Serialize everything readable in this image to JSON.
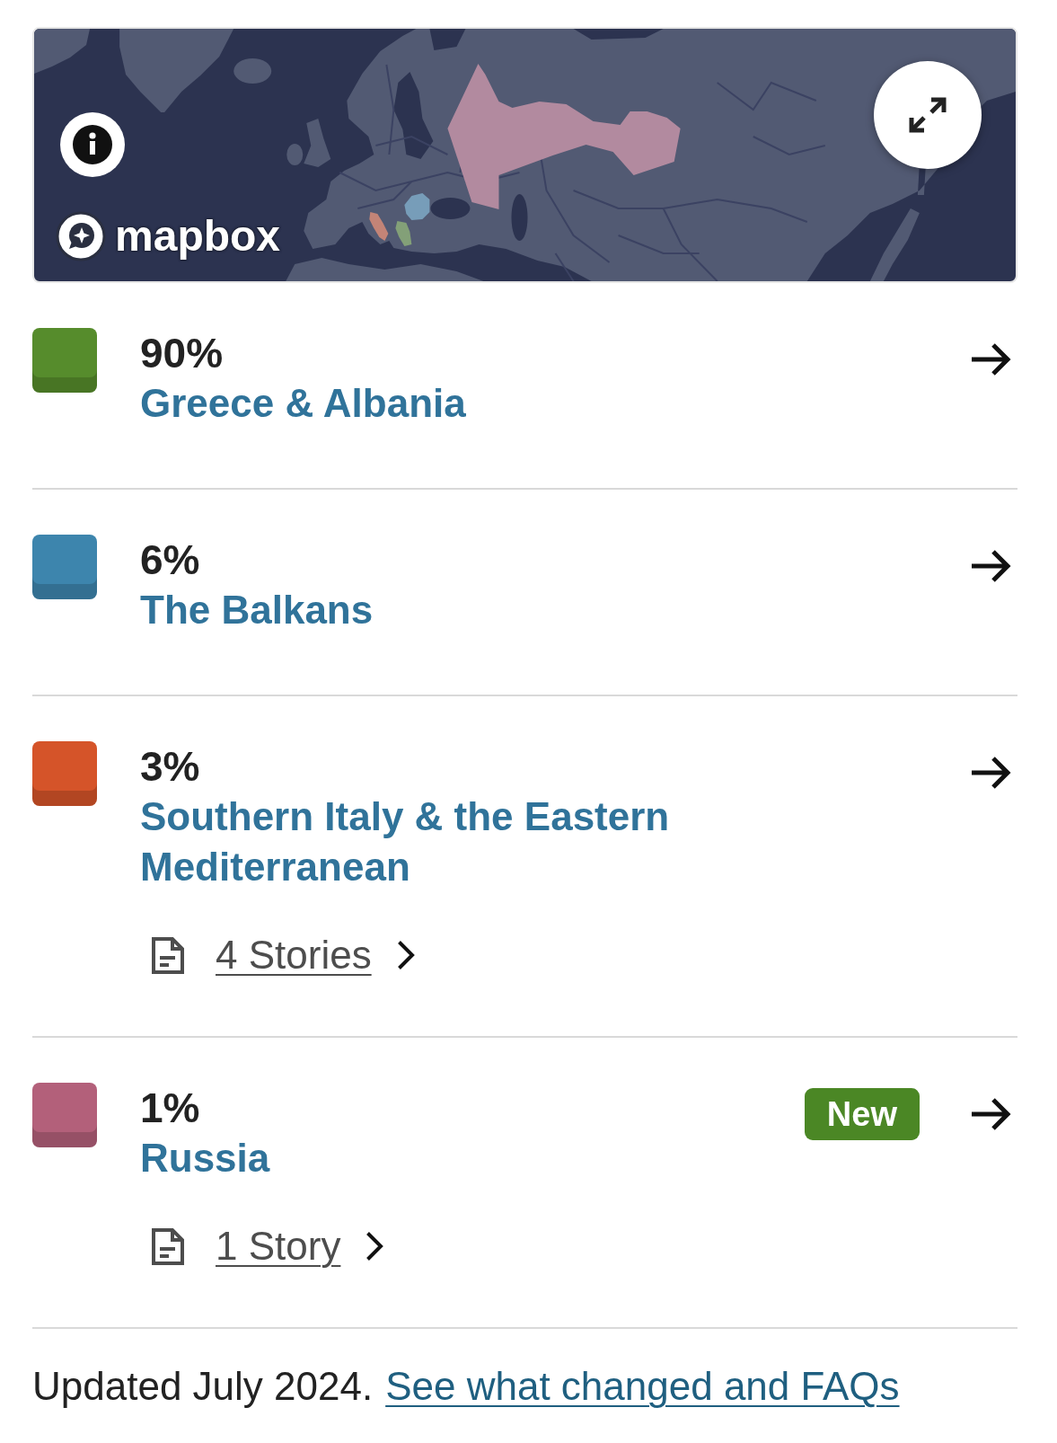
{
  "map": {
    "logo_text": "mapbox"
  },
  "ancestry": [
    {
      "percent": "90%",
      "region": "Greece & Albania",
      "color": "#568c2c"
    },
    {
      "percent": "6%",
      "region": "The Balkans",
      "color": "#3d85ad"
    },
    {
      "percent": "3%",
      "region": "Southern Italy & the Eastern Mediterranean",
      "color": "#d55429",
      "stories": "4 Stories"
    },
    {
      "percent": "1%",
      "region": "Russia",
      "color": "#b3607a",
      "badge": "New",
      "stories": "1 Story"
    }
  ],
  "footer": {
    "note": "Updated July 2024.",
    "link": "See what changed and FAQs"
  }
}
